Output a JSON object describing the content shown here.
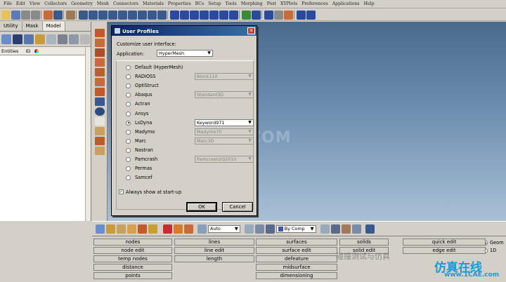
{
  "menubar": [
    "File",
    "Edit",
    "View",
    "Collectors",
    "Geometry",
    "Mesh",
    "Connectors",
    "Materials",
    "Properties",
    "BCs",
    "Setup",
    "Tools",
    "Morphing",
    "Post",
    "XYPlots",
    "Preferences",
    "Applications",
    "Help"
  ],
  "left_panel": {
    "tabs": [
      "Utility",
      "Mask",
      "Model"
    ],
    "columns": [
      "Entities",
      "ID"
    ]
  },
  "dialog": {
    "title": "User Profiles",
    "customize_label": "Customize user interface:",
    "application_label": "Application:",
    "application_value": "HyperMesh",
    "profiles": [
      {
        "label": "Default (HyperMesh)",
        "checked": false
      },
      {
        "label": "RADIOSS",
        "checked": false,
        "option": "Block110",
        "option_enabled": false
      },
      {
        "label": "OptiStruct",
        "checked": false
      },
      {
        "label": "Abaqus",
        "checked": false,
        "option": "Standard3D",
        "option_enabled": false
      },
      {
        "label": "Actran",
        "checked": false
      },
      {
        "label": "Ansys",
        "checked": false
      },
      {
        "label": "LsDyna",
        "checked": true,
        "option": "Keyword971",
        "option_enabled": true
      },
      {
        "label": "Madymo",
        "checked": false,
        "option": "Madymo70",
        "option_enabled": false
      },
      {
        "label": "Marc",
        "checked": false,
        "option": "Marc3D",
        "option_enabled": false
      },
      {
        "label": "Nastran",
        "checked": false
      },
      {
        "label": "Pamcrash",
        "checked": false,
        "option": "Pamcrash2G2010",
        "option_enabled": false
      },
      {
        "label": "Permas",
        "checked": false
      },
      {
        "label": "Samcef",
        "checked": false
      }
    ],
    "always_show_label": "Always show at start-up",
    "always_show_checked": true,
    "ok_label": "OK",
    "cancel_label": "Cancel"
  },
  "viewport": {
    "watermark": "1CAE.COM"
  },
  "bottom_toolbar": {
    "mode_value": "Auto",
    "color_value": "By Comp"
  },
  "bottom_panel": {
    "col1": [
      "nodes",
      "node edit",
      "temp nodes",
      "distance",
      "points"
    ],
    "col2": [
      "lines",
      "line edit",
      "length"
    ],
    "col3": [
      "surfaces",
      "surface edit",
      "defeature",
      "midsurface",
      "dimensioning"
    ],
    "col4": [
      "solids",
      "solid edit"
    ],
    "col5": [
      "quick edit",
      "edge edit"
    ],
    "radios": [
      {
        "label": "Geom",
        "checked": true
      },
      {
        "label": "1D",
        "checked": false
      }
    ]
  },
  "watermarks": {
    "wechat": "碰撞测试与仿真",
    "site_cn": "仿真在线",
    "site_url": "www.1CAE.com"
  },
  "colors": {
    "titlebar": "#0a246a",
    "viewport_top": "#4a6a8c",
    "viewport_bottom": "#a9c0d6",
    "watermark_blue": "#1a9ad6"
  }
}
